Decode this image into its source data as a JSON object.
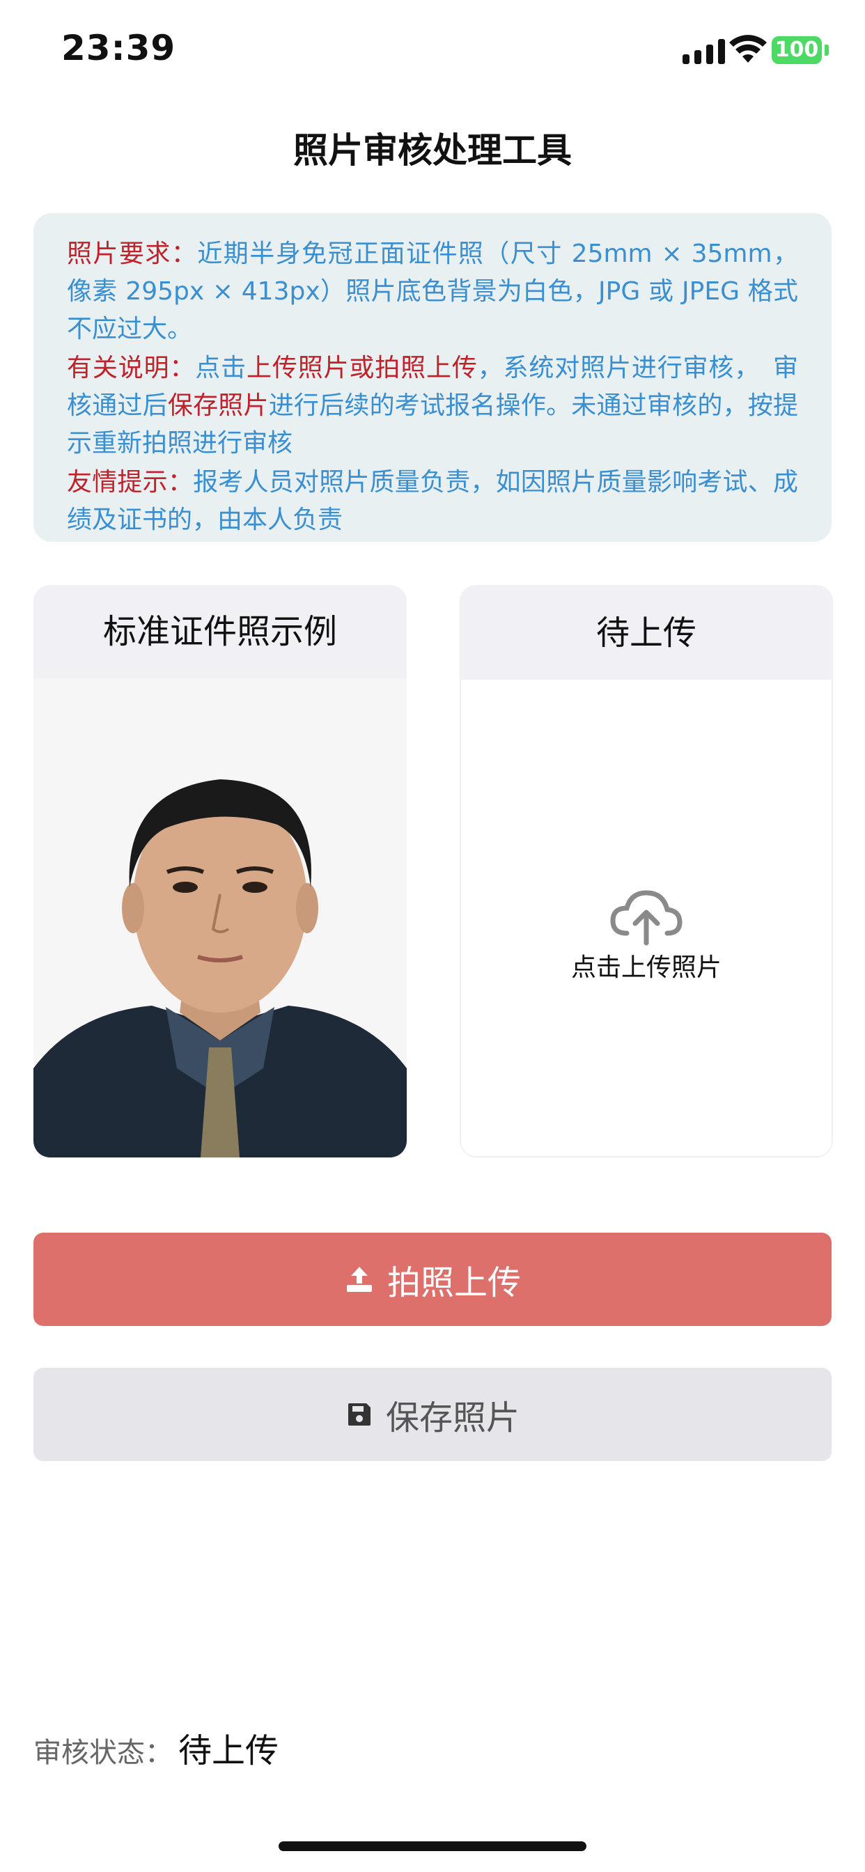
{
  "status_bar": {
    "time": "23:39",
    "battery": "100"
  },
  "page": {
    "title": "照片审核处理工具"
  },
  "notice": {
    "req_label": "照片要求：",
    "req_text": "近期半身免冠正面证件照（尺寸 25mm × 35mm，像素 295px × 413px）照片底色背景为白色，JPG 或 JPEG 格式不应过大。",
    "desc_label": "有关说明：",
    "desc_part1": "点击",
    "desc_red1": "上传照片或拍照上传",
    "desc_part2": "，系统对照片进行审核，　审核通过后",
    "desc_red2": "保存照片",
    "desc_part3": "进行后续的考试报名操作。未通过审核的，按提示重新拍照进行审核",
    "tip_label": "友情提示：",
    "tip_text": "报考人员对照片质量负责，如因照片质量影响考试、成绩及证书的，由本人负责"
  },
  "sample_card": {
    "title": "标准证件照示例"
  },
  "upload_card": {
    "title": "待上传",
    "hint": "点击上传照片"
  },
  "buttons": {
    "take_photo": "拍照上传",
    "save_photo": "保存照片"
  },
  "status": {
    "label": "审核状态：",
    "value": "待上传"
  },
  "colors": {
    "primary": "#dd706b",
    "notice_bg": "#e9f0f2",
    "notice_text": "#3a8fd0",
    "notice_red": "#c0212b"
  }
}
